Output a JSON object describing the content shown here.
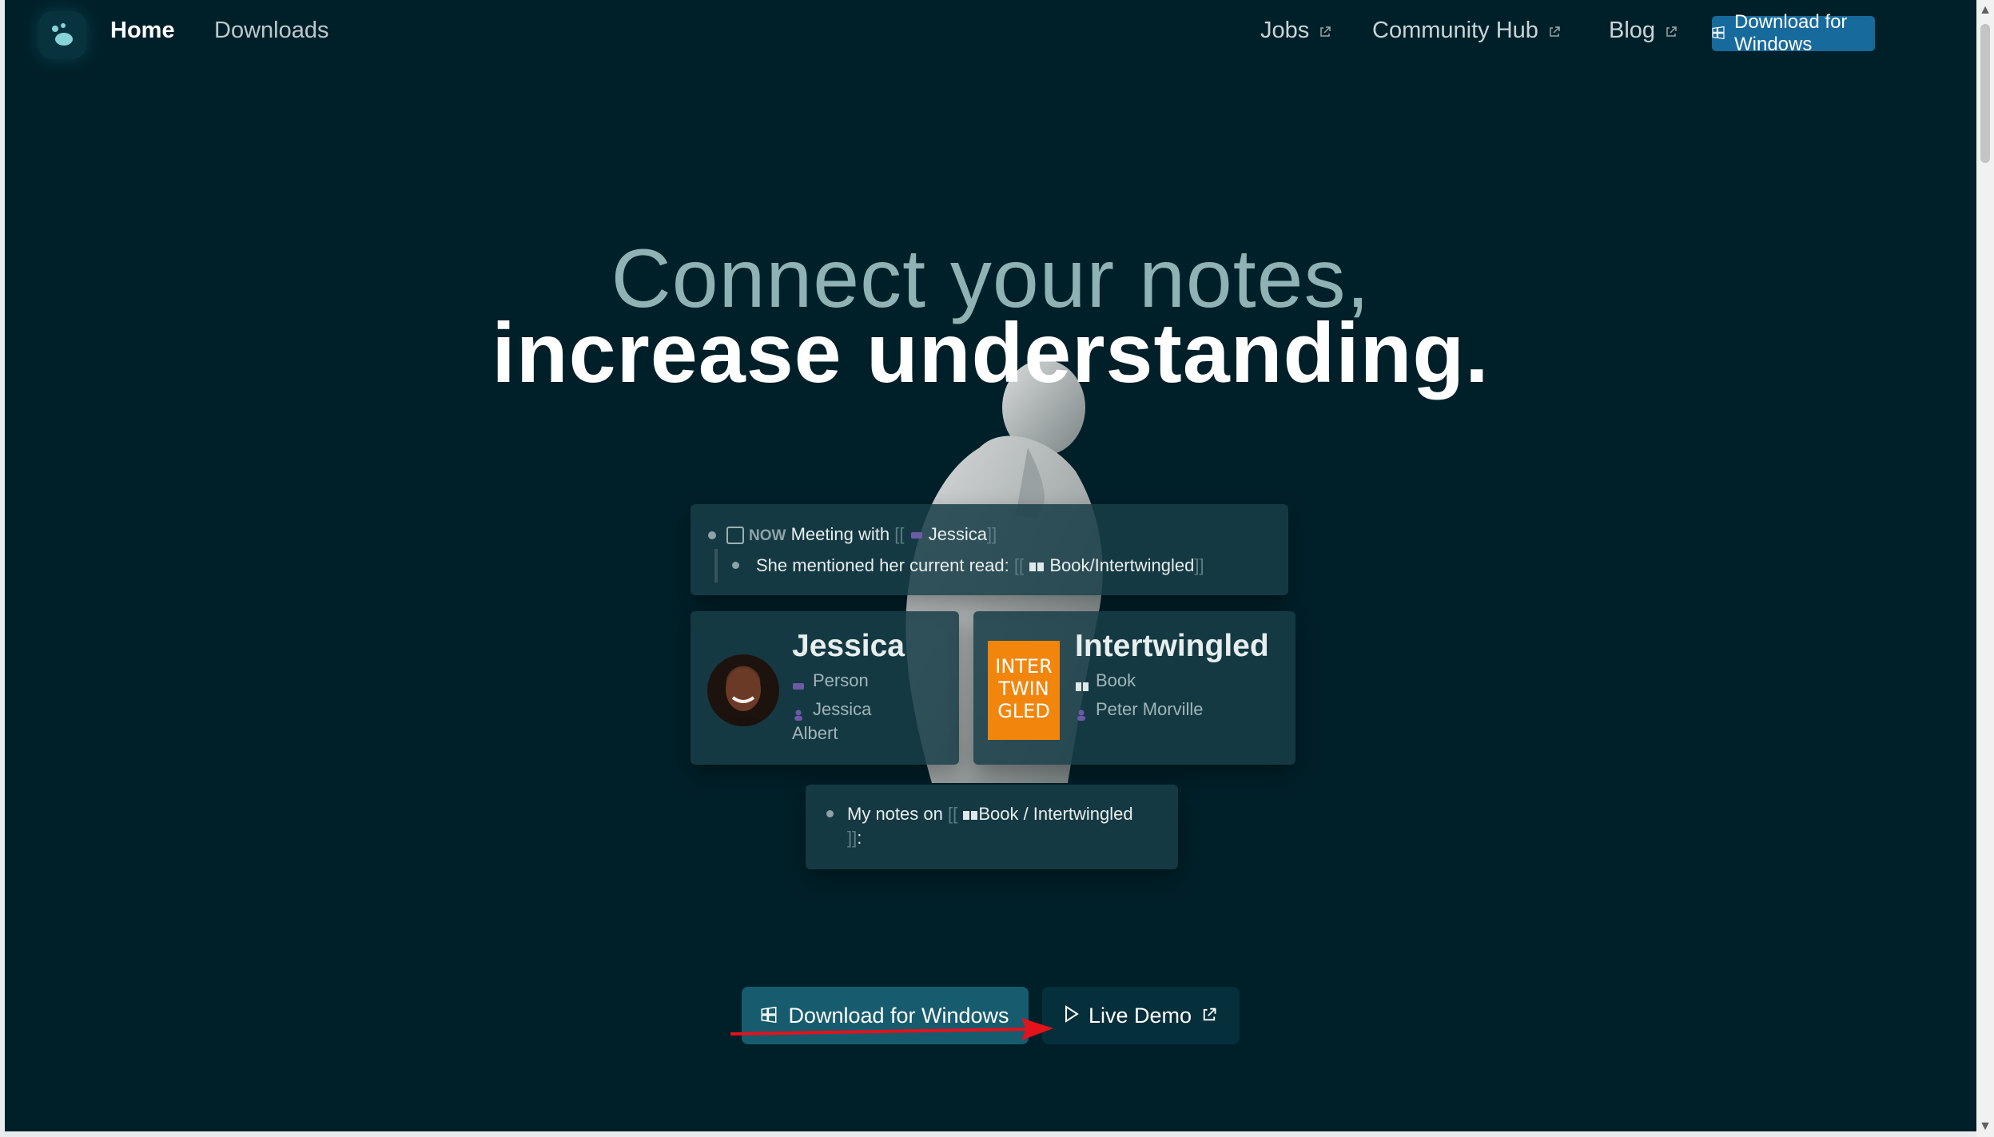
{
  "nav": {
    "home": "Home",
    "downloads": "Downloads",
    "jobs": "Jobs",
    "community_hub": "Community Hub",
    "blog": "Blog",
    "download_button": "Download for Windows"
  },
  "hero": {
    "line1": "Connect your notes,",
    "line2": "increase understanding."
  },
  "block": {
    "now": "NOW",
    "meeting_with": "Meeting with",
    "link_open": "[[",
    "link_close": "]]",
    "jessica": "Jessica",
    "mentioned": "She mentioned her current read:",
    "book_page": "Book/Intertwingled"
  },
  "jessica_card": {
    "title": "Jessica",
    "type": "Person",
    "name_line1": "Jessica",
    "name_line2": "Albert"
  },
  "book_card": {
    "title": "Intertwingled",
    "type": "Book",
    "author": "Peter Morville",
    "cover_text": "INTER TWIN GLED"
  },
  "notes": {
    "prefix": "My notes on",
    "link_open": "[[",
    "page": "Book / Intertwingled",
    "link_close": "]]",
    "suffix": ":"
  },
  "cta": {
    "download": "Download for Windows",
    "demo": "Live Demo"
  },
  "colors": {
    "background": "#002029",
    "accent_button": "#176a9c",
    "cta_primary": "#175c6e",
    "annotation_arrow": "#e3121c"
  }
}
